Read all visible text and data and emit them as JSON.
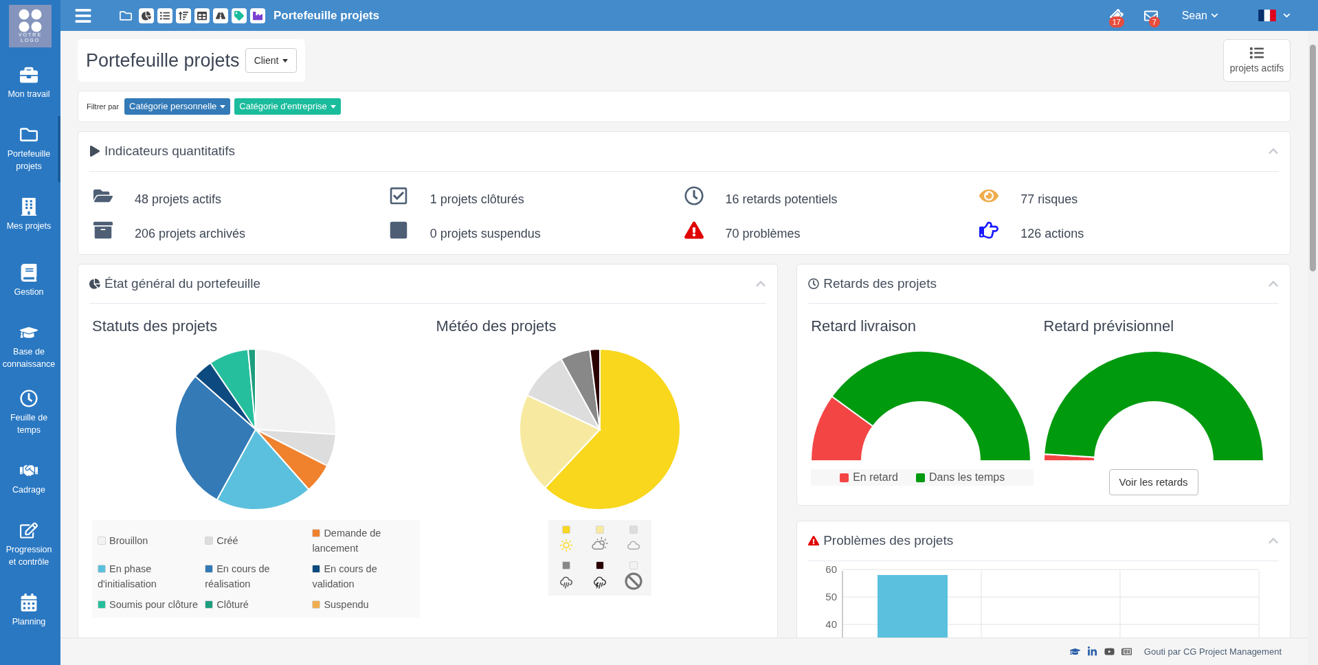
{
  "topbar": {
    "title": "Portefeuille projets",
    "notifications": "17",
    "messages": "7",
    "user": "Sean"
  },
  "sidebar": {
    "logo_lines": [
      "VOTRE",
      "LOGO"
    ],
    "items": [
      {
        "kind": "briefcase",
        "label": "Mon travail",
        "selected": false
      },
      {
        "kind": "folder",
        "label": "Portefeuille projets",
        "selected": true
      },
      {
        "kind": "building",
        "label": "Mes projets",
        "selected": false
      },
      {
        "kind": "book",
        "label": "Gestion",
        "selected": false
      },
      {
        "kind": "cap",
        "label": "Base de connaissance",
        "selected": false
      },
      {
        "kind": "clock",
        "label": "Feuille de temps",
        "selected": false
      },
      {
        "kind": "handshake",
        "label": "Cadrage",
        "selected": false
      },
      {
        "kind": "edit",
        "label": "Progression et contrôle",
        "selected": false
      },
      {
        "kind": "calendar",
        "label": "Planning",
        "selected": false
      }
    ]
  },
  "page_header": {
    "title": "Portefeuille projets",
    "dropdown": "Client",
    "view_button": "projets actifs"
  },
  "filter": {
    "label": "Filtrer par",
    "buttons": [
      {
        "label": "Catégorie personnelle",
        "color": "#337ab7"
      },
      {
        "label": "Catégorie d'entreprise",
        "color": "#1abc9c"
      }
    ]
  },
  "indicators": {
    "title": "Indicateurs quantitatifs",
    "items": [
      {
        "kind": "folder",
        "text": "48 projets actifs",
        "color": "#4e5f75"
      },
      {
        "kind": "check",
        "text": "1 projets clôturés",
        "color": "#4e5f75"
      },
      {
        "kind": "clock",
        "text": "16 retards potentiels",
        "color": "#4e5f75"
      },
      {
        "kind": "eye",
        "text": "77 risques",
        "color": "#f0ad4e"
      },
      {
        "kind": "archive",
        "text": "206 projets archivés",
        "color": "#4e5f75"
      },
      {
        "kind": "square",
        "text": "0 projets suspendus",
        "color": "#4e5f75"
      },
      {
        "kind": "warning",
        "text": "70 problèmes",
        "color": "#e00000"
      },
      {
        "kind": "hand",
        "text": "126 actions",
        "color": "#1a1aff"
      }
    ]
  },
  "portfolio": {
    "title": "État général du portefeuille",
    "status_chart": {
      "title": "Statuts des projets",
      "legend": [
        {
          "label": "Brouillon",
          "color": "#f2f2f2"
        },
        {
          "label": "Créé",
          "color": "#dddddd"
        },
        {
          "label": "Demande de lancement",
          "color": "#f0812d"
        },
        {
          "label": "En phase d'initialisation",
          "color": "#5bc0de"
        },
        {
          "label": "En cours de réalisation",
          "color": "#337ab7"
        },
        {
          "label": "En cours de validation",
          "color": "#0d4a80"
        },
        {
          "label": "Soumis pour clôture",
          "color": "#26bf9d"
        },
        {
          "label": "Clôturé",
          "color": "#1e9e7e"
        },
        {
          "label": "Suspendu",
          "color": "#f0ad4e"
        }
      ]
    },
    "weather_chart": {
      "title": "Météo des projets",
      "legend": [
        {
          "kind": "sun",
          "color": "#f8d71c"
        },
        {
          "kind": "sun-cloud",
          "color": "#f7eaa0"
        },
        {
          "kind": "cloud",
          "color": "#dddddd"
        },
        {
          "kind": "rain",
          "color": "#888888"
        },
        {
          "kind": "storm",
          "color": "#2b0000"
        },
        {
          "kind": "none",
          "color": "#f2f2f2"
        }
      ]
    }
  },
  "delays": {
    "title": "Retards des projets",
    "delivery": {
      "title": "Retard livraison",
      "legend": [
        {
          "label": "En retard",
          "color": "#f44545"
        },
        {
          "label": "Dans les temps",
          "color": "#009a0f"
        }
      ]
    },
    "forecast": {
      "title": "Retard prévisionnel",
      "button": "Voir les retards"
    }
  },
  "problems": {
    "title": "Problèmes des projets",
    "chart_data": {
      "type": "bar",
      "values": [
        58
      ],
      "ylim": [
        30,
        60
      ],
      "yticks": [
        40,
        50,
        60
      ]
    }
  },
  "footer": {
    "credit": "Gouti par CG Project Management"
  }
}
